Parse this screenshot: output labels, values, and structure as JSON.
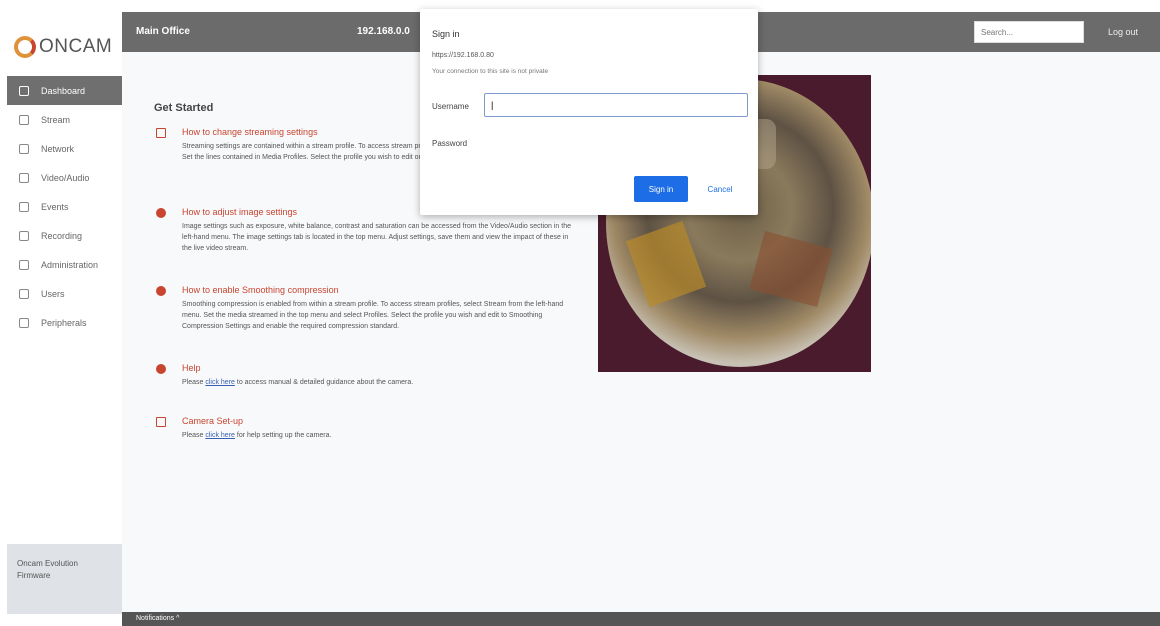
{
  "brand": {
    "logo_text": "ONCAM",
    "accent": "#c8452f",
    "header_color": "#6b6b6b"
  },
  "topbar": {
    "site_name": "Main Office",
    "ip_address": "192.168.0.0",
    "search_placeholder": "Search...",
    "logout_label": "Log out"
  },
  "sidebar": {
    "items": [
      {
        "label": "Dashboard",
        "icon": "dashboard-icon",
        "active": true
      },
      {
        "label": "Stream",
        "icon": "stream-icon"
      },
      {
        "label": "Network",
        "icon": "network-icon"
      },
      {
        "label": "Video/Audio",
        "icon": "video-icon"
      },
      {
        "label": "Events",
        "icon": "events-icon"
      },
      {
        "label": "Recording",
        "icon": "recording-icon"
      },
      {
        "label": "Administration",
        "icon": "admin-icon"
      },
      {
        "label": "Users",
        "icon": "users-icon"
      },
      {
        "label": "Peripherals",
        "icon": "peripherals-icon"
      }
    ],
    "footer": {
      "line1": "Oncam Evolution",
      "line2": "Firmware"
    }
  },
  "main": {
    "heading": "Get Started",
    "guides": [
      {
        "title": "How to change streaming settings",
        "icon": "stream-settings-icon",
        "desc": "Streaming settings are contained within a stream profile. To access stream profiles, select Stream from the left-hand menu. Set the lines contained in Media Profiles. Select the profile you wish to edit or add a new one."
      },
      {
        "title": "How to adjust image settings",
        "icon": "image-settings-icon",
        "desc": "Image settings such as exposure, white balance, contrast and saturation can be accessed from the Video/Audio section in the left-hand menu. The image settings tab is located in the top menu. Adjust settings, save them and view the impact of these in the live video stream."
      },
      {
        "title": "How to enable Smoothing compression",
        "icon": "compression-icon",
        "desc": "Smoothing compression is enabled from within a stream profile. To access stream profiles, select Stream from the left-hand menu. Set the media streamed in the top menu and select Profiles. Select the profile you wish and edit to Smoothing Compression Settings and enable the required compression standard."
      },
      {
        "title": "Help",
        "icon": "help-icon",
        "desc_before": "Please ",
        "link": "click here",
        "desc_after": " to access manual & detailed guidance about the camera."
      },
      {
        "title": "Camera Set-up",
        "icon": "setup-icon",
        "desc_before": "Please ",
        "link": "click here",
        "desc_after": " for help setting up the camera."
      }
    ]
  },
  "bottombar": {
    "label": "Notifications ^"
  },
  "dialog": {
    "title": "Sign in",
    "url": "https://192.168.0.80",
    "note": "Your connection to this site is not private",
    "username_label": "Username",
    "username_value": "|",
    "password_label": "Password",
    "signin_label": "Sign in",
    "cancel_label": "Cancel"
  }
}
